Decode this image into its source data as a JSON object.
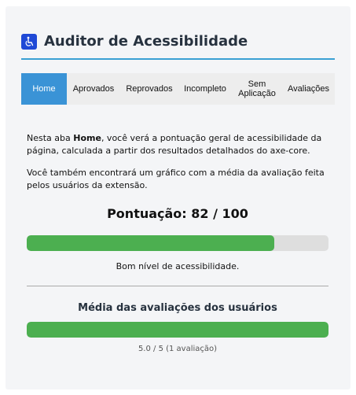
{
  "header": {
    "title": "Auditor de Acessibilidade",
    "logo_icon": "wheelchair-icon",
    "logo_color": "#1f49d6",
    "accent_color": "#3aa0d4"
  },
  "tabs": [
    {
      "label": "Home",
      "active": true
    },
    {
      "label": "Aprovados",
      "active": false
    },
    {
      "label": "Reprovados",
      "active": false
    },
    {
      "label": "Incompleto",
      "active": false
    },
    {
      "label": "Sem\nAplicação",
      "active": false
    },
    {
      "label": "Avaliações",
      "active": false
    }
  ],
  "home": {
    "intro_prefix": "Nesta aba ",
    "intro_bold": "Home",
    "intro_suffix": ", você verá a pontuação geral de acessibilidade da página, calculada a partir dos resultados detalhados do axe-core.",
    "chart_text": "Você também encontrará um gráfico com a média da avaliação feita pelos usuários da extensão.",
    "score_label": "Pontuação: 82 / 100",
    "score_value": 82,
    "score_max": 100,
    "status_text": "Bom nível de acessibilidade.",
    "ratings_title": "Média das avaliações dos usuários",
    "rating_value": 5.0,
    "rating_max": 5,
    "rating_text": "5.0 / 5 (1 avaliação)",
    "bar_color": "#4caf50"
  }
}
